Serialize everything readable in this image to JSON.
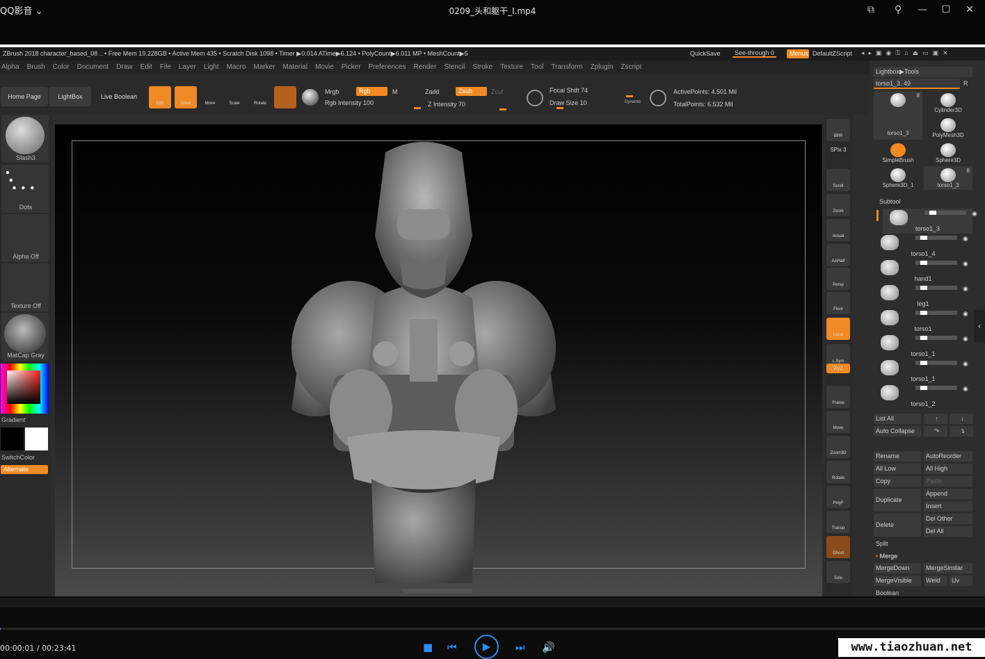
{
  "player": {
    "app_name": "QQ影音",
    "title": "0209_头和躯干_I.mp4",
    "time": "00:00:01 / 00:23:41",
    "watermark": "www.tiaozhuan.net"
  },
  "zbrush": {
    "status": "ZBrush 2018   character_based_08   .. • Free Mem 19.228GB • Active Mem 435 • Scratch Disk 1098 •  Timer ▶0.014 ATime▶6.124 • PolyCount▶6.011 MP  • MeshCount▶5",
    "quicksave": "QuickSave",
    "see_through": "See-through  0",
    "menus": "Menus",
    "default_zscript": "DefaultZScript",
    "menu_items": [
      "Alpha",
      "Brush",
      "Color",
      "Document",
      "Draw",
      "Edit",
      "File",
      "Layer",
      "Light",
      "Macro",
      "Marker",
      "Material",
      "Movie",
      "Picker",
      "Preferences",
      "Render",
      "Stencil",
      "Stroke",
      "Texture",
      "Tool",
      "Transform",
      "Zplugin",
      "Zscript"
    ],
    "shelf": {
      "home_page": "Home Page",
      "lightbox": "LightBox",
      "live_boolean": "Live Boolean",
      "edit": "Edit",
      "draw": "Draw",
      "move": "Move",
      "scale": "Scale",
      "rotate": "Rotate",
      "mrgb": "Mrgb",
      "rgb": "Rgb",
      "m": "M",
      "zadd": "Zadd",
      "zsub": "Zsub",
      "zcut": "Zcut",
      "rgb_intensity": "Rgb Intensity 100",
      "z_intensity": "Z Intensity 70",
      "focal_shift": "Focal Shift 74",
      "draw_size": "Draw Size 10",
      "dynamic": "Dynamic",
      "active_points": "ActivePoints: 4.501 Mil",
      "total_points": "TotalPoints: 6.532 Mil"
    },
    "left_panel": {
      "brush": "Slash3",
      "stroke": "Dots",
      "alpha": "Alpha Off",
      "texture": "Texture Off",
      "material": "MatCap Gray",
      "gradient": "Gradient",
      "switch_color": "SwitchColor",
      "alternate": "Alternate"
    },
    "right_tools": [
      "BPR",
      "SPix 3",
      "Scroll",
      "Zoom",
      "Actual",
      "AAHalf",
      "Persp",
      "Floor",
      "Local",
      "L.Sym",
      "Xyz",
      "Frame",
      "Move",
      "Zoom3D",
      "Rotate",
      "PolyF",
      "Transp",
      "Ghost",
      "Solo"
    ],
    "tool_panel": {
      "lightbox_tools": "Lightbox▶Tools",
      "current_tool": "torso1_3. 49",
      "r": "R",
      "tools": [
        {
          "name": "torso1_3",
          "count": "8"
        },
        {
          "name": "Cylinder3D",
          "count": ""
        },
        {
          "name": "PolyMesh3D",
          "count": ""
        },
        {
          "name": "SimpleBrush",
          "count": ""
        },
        {
          "name": "Sphere3D",
          "count": ""
        },
        {
          "name": "Sphere3D_1",
          "count": ""
        },
        {
          "name": "torso1_3",
          "count": "8"
        }
      ],
      "subtool_header": "Subtool",
      "subtools": [
        "torso1_3",
        "torso1_4",
        "hand1",
        "leg1",
        "torso1",
        "torso1_1",
        "torso1_1",
        "torso1_2"
      ],
      "list_all": "List All",
      "auto_collapse": "Auto Collapse",
      "rename": "Rename",
      "auto_reorder": "AutoReorder",
      "all_low": "All Low",
      "all_high": "All High",
      "copy": "Copy",
      "paste": "Paste",
      "duplicate": "Duplicate",
      "append": "Append",
      "insert": "Insert",
      "delete": "Delete",
      "del_other": "Del Other",
      "del_all": "Del All",
      "split": "Split",
      "merge": "Merge",
      "merge_down": "MergeDown",
      "merge_similar": "MergeSimilar",
      "merge_visible": "MergeVisible",
      "weld": "Weld",
      "uv": "Uv",
      "boolean": "Boolean"
    }
  }
}
